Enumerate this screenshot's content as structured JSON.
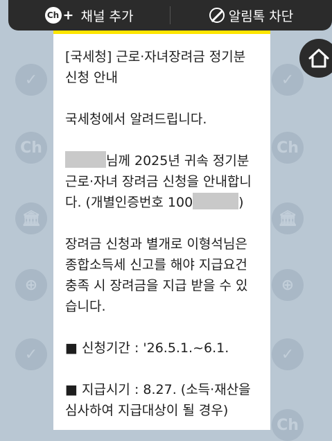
{
  "topbar": {
    "add_channel_label": "채널 추가",
    "add_channel_icon": "Ch",
    "block_label": "알림톡 차단"
  },
  "home_button": {
    "icon": "home-icon"
  },
  "background_icons": [
    "Ch",
    "✓",
    "🏛",
    "⊕"
  ],
  "message": {
    "title": "[국세청] 근로·자녀장려금 정기분 신청 안내",
    "greeting": "국세청에서 알려드립니다.",
    "para1_part1": "님께 2025년 귀속 정기분 근로·자녀 장려금 신청을 안내합니다. (개별인증번호 100",
    "para1_part2": ")",
    "para2": "장려금 신청과 별개로 이형석님은 종합소득세 신고를 해야 지급요건 충족 시 장려금을 지급 받을 수 있습니다.",
    "period": "■ 신청기간 : '26.5.1.~6.1.",
    "payment": "■ 지급시기 : 8.27. (소득·재산을 심사하여 지급대상이 될 경우)"
  },
  "colors": {
    "background": "#b9c7d3",
    "topbar": "#2b2b2b",
    "card_accent": "#fee500"
  }
}
